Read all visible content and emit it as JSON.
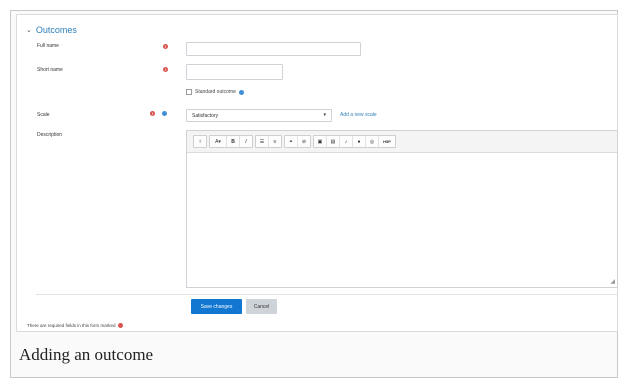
{
  "section": {
    "title": "Outcomes"
  },
  "fields": {
    "fullname": {
      "label": "Full name",
      "value": ""
    },
    "shortname": {
      "label": "Short name",
      "value": ""
    },
    "standard": {
      "label": "Standard outcome",
      "checked": false
    },
    "scale": {
      "label": "Scale",
      "selected": "Satisfactory",
      "add_link": "Add a new scale"
    },
    "description": {
      "label": "Description",
      "value": ""
    }
  },
  "editor_toolbar": {
    "group1": [
      {
        "icon": "info-icon",
        "glyph": "i"
      }
    ],
    "group2": [
      {
        "icon": "font-size-icon",
        "glyph": "A▾"
      },
      {
        "icon": "bold-icon",
        "glyph": "B"
      },
      {
        "icon": "italic-icon",
        "glyph": "I"
      }
    ],
    "group3": [
      {
        "icon": "bullet-list-icon",
        "glyph": "☰"
      },
      {
        "icon": "numbered-list-icon",
        "glyph": "≡"
      }
    ],
    "group4": [
      {
        "icon": "link-icon",
        "glyph": "⚭"
      },
      {
        "icon": "unlink-icon",
        "glyph": "⊘"
      }
    ],
    "group5": [
      {
        "icon": "image-icon",
        "glyph": "▣"
      },
      {
        "icon": "media-icon",
        "glyph": "▤"
      },
      {
        "icon": "record-audio-icon",
        "glyph": "♪"
      },
      {
        "icon": "record-video-icon",
        "glyph": "●"
      },
      {
        "icon": "manage-files-icon",
        "glyph": "◎"
      },
      {
        "icon": "h5p-icon",
        "glyph": "H5P"
      }
    ]
  },
  "actions": {
    "save": "Save changes",
    "cancel": "Cancel"
  },
  "footnote": "There are required fields in this form marked",
  "caption": "Adding an outcome",
  "colors": {
    "accent": "#1177d1",
    "link": "#2f7fb9",
    "required": "#d9534f"
  }
}
